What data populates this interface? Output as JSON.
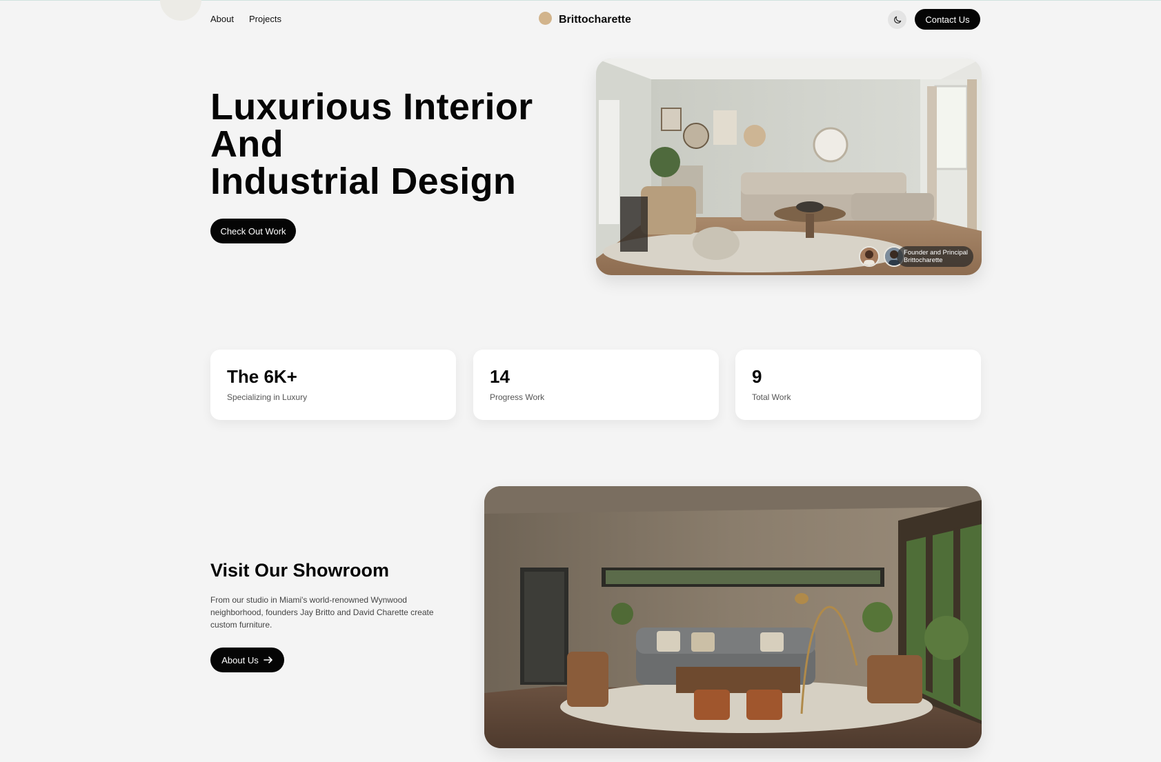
{
  "nav": {
    "about_label": "About",
    "projects_label": "Projects",
    "brand": "Brittocharette",
    "theme_icon": "moon-icon",
    "contact_label": "Contact Us"
  },
  "hero": {
    "title_line1": "Luxurious Interior",
    "title_line2": "And",
    "title_line3": "Industrial Design",
    "cta_label": "Check Out Work",
    "founder_line1": "Founder and Principal",
    "founder_line2": "Brittocharette"
  },
  "stats": [
    {
      "value": "The 6K+",
      "label": "Specializing in Luxury"
    },
    {
      "value": "14",
      "label": "Progress Work"
    },
    {
      "value": "9",
      "label": "Total Work"
    }
  ],
  "showroom": {
    "title": "Visit Our Showroom",
    "description": "From our studio in Miami's world-renowned Wynwood neighborhood, founders Jay Britto and David Charette create custom furniture.",
    "button_label": "About Us",
    "button_icon": "arrow-right-icon"
  },
  "colors": {
    "background": "#f4f4f4",
    "button": "#050505",
    "logo_dot": "#d2b48c"
  }
}
